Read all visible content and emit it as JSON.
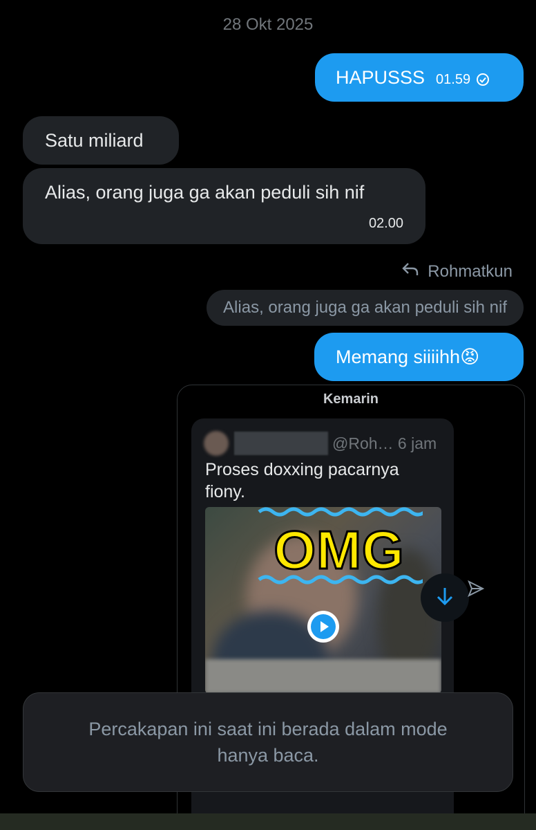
{
  "date_separator": "28 Okt 2025",
  "messages": [
    {
      "direction": "outgoing",
      "text": "HAPUSSS",
      "time": "01.59",
      "status_icon": "check-circle-icon"
    },
    {
      "direction": "incoming",
      "text": "Satu miliard"
    },
    {
      "direction": "incoming",
      "text": "Alias, orang juga ga akan peduli sih nif",
      "time": "02.00"
    },
    {
      "direction": "outgoing",
      "text": "Memang siiiihh😡",
      "reply_to": {
        "author": "Rohmatkun",
        "text": "Alias, orang juga ga akan peduli sih nif"
      }
    }
  ],
  "shared_post": {
    "day_label": "Kemarin",
    "handle_meta": "@Roh… 6 jam",
    "text": "Proses doxxing pacarnya fiony.",
    "sticker_text": "OMG"
  },
  "notice": "Percakapan ini saat ini berada dalam mode hanya baca.",
  "colors": {
    "background": "#000000",
    "outgoing_bubble": "#1d9bf0",
    "incoming_bubble": "#202327",
    "muted_text": "#71767b",
    "sticker": "#ffe800"
  }
}
